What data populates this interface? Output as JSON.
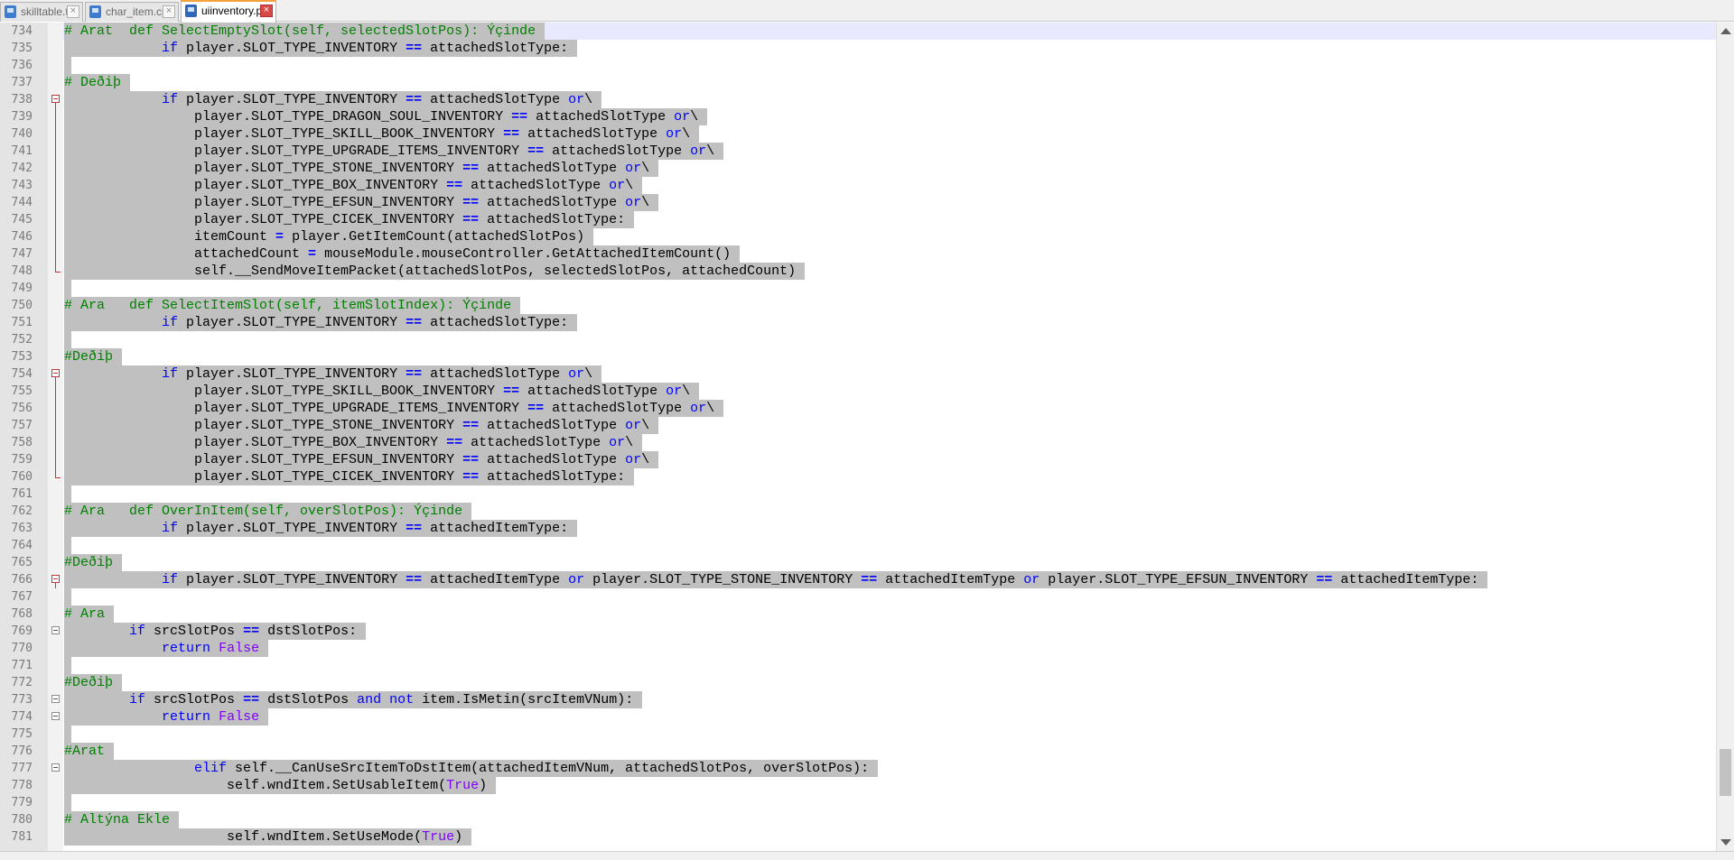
{
  "tabs": [
    {
      "label": "skilltable.txt",
      "active": false,
      "icon": "file-icon"
    },
    {
      "label": "char_item.cpp",
      "active": false,
      "icon": "file-icon"
    },
    {
      "label": "uiinventory.py",
      "active": true,
      "icon": "file-icon"
    }
  ],
  "colors": {
    "comment": "#008000",
    "keyword": "#0000ff",
    "boolean": "#8000ff",
    "selection": "#c0c0c0",
    "fold_marker": "#d03030",
    "active_tab_accent": "#f4a23c"
  },
  "editor": {
    "current_line": 734,
    "lines": [
      {
        "n": "734",
        "fold": null,
        "segs": [
          [
            "c",
            "# Arat  def SelectEmptySlot(self, selectedSlotPos): Ýçinde"
          ]
        ]
      },
      {
        "n": "735",
        "fold": null,
        "segs": [
          [
            "t",
            "            "
          ],
          [
            "k",
            "if"
          ],
          [
            "t",
            " player.SLOT_TYPE_INVENTORY "
          ],
          [
            "o",
            "=="
          ],
          [
            "t",
            " attachedSlotType:"
          ]
        ]
      },
      {
        "n": "736",
        "fold": null,
        "segs": []
      },
      {
        "n": "737",
        "fold": null,
        "segs": [
          [
            "c",
            "# Deðiþ"
          ]
        ]
      },
      {
        "n": "738",
        "fold": "start",
        "segs": [
          [
            "t",
            "            "
          ],
          [
            "k",
            "if"
          ],
          [
            "t",
            " player.SLOT_TYPE_INVENTORY "
          ],
          [
            "o",
            "=="
          ],
          [
            "t",
            " attachedSlotType "
          ],
          [
            "k",
            "or"
          ],
          [
            "t",
            "\\"
          ]
        ]
      },
      {
        "n": "739",
        "fold": "mid",
        "segs": [
          [
            "t",
            "                player.SLOT_TYPE_DRAGON_SOUL_INVENTORY "
          ],
          [
            "o",
            "=="
          ],
          [
            "t",
            " attachedSlotType "
          ],
          [
            "k",
            "or"
          ],
          [
            "t",
            "\\"
          ]
        ]
      },
      {
        "n": "740",
        "fold": "mid",
        "segs": [
          [
            "t",
            "                player.SLOT_TYPE_SKILL_BOOK_INVENTORY "
          ],
          [
            "o",
            "=="
          ],
          [
            "t",
            " attachedSlotType "
          ],
          [
            "k",
            "or"
          ],
          [
            "t",
            "\\"
          ]
        ]
      },
      {
        "n": "741",
        "fold": "mid",
        "segs": [
          [
            "t",
            "                player.SLOT_TYPE_UPGRADE_ITEMS_INVENTORY "
          ],
          [
            "o",
            "=="
          ],
          [
            "t",
            " attachedSlotType "
          ],
          [
            "k",
            "or"
          ],
          [
            "t",
            "\\"
          ]
        ]
      },
      {
        "n": "742",
        "fold": "mid",
        "segs": [
          [
            "t",
            "                player.SLOT_TYPE_STONE_INVENTORY "
          ],
          [
            "o",
            "=="
          ],
          [
            "t",
            " attachedSlotType "
          ],
          [
            "k",
            "or"
          ],
          [
            "t",
            "\\"
          ]
        ]
      },
      {
        "n": "743",
        "fold": "mid",
        "segs": [
          [
            "t",
            "                player.SLOT_TYPE_BOX_INVENTORY "
          ],
          [
            "o",
            "=="
          ],
          [
            "t",
            " attachedSlotType "
          ],
          [
            "k",
            "or"
          ],
          [
            "t",
            "\\"
          ]
        ]
      },
      {
        "n": "744",
        "fold": "mid",
        "segs": [
          [
            "t",
            "                player.SLOT_TYPE_EFSUN_INVENTORY "
          ],
          [
            "o",
            "=="
          ],
          [
            "t",
            " attachedSlotType "
          ],
          [
            "k",
            "or"
          ],
          [
            "t",
            "\\"
          ]
        ]
      },
      {
        "n": "745",
        "fold": "mid",
        "segs": [
          [
            "t",
            "                player.SLOT_TYPE_CICEK_INVENTORY "
          ],
          [
            "o",
            "=="
          ],
          [
            "t",
            " attachedSlotType:"
          ]
        ]
      },
      {
        "n": "746",
        "fold": "mid",
        "segs": [
          [
            "t",
            "                itemCount "
          ],
          [
            "o",
            "="
          ],
          [
            "t",
            " player.GetItemCount(attachedSlotPos)"
          ]
        ]
      },
      {
        "n": "747",
        "fold": "mid",
        "segs": [
          [
            "t",
            "                attachedCount "
          ],
          [
            "o",
            "="
          ],
          [
            "t",
            " mouseModule.mouseController.GetAttachedItemCount()"
          ]
        ]
      },
      {
        "n": "748",
        "fold": "end",
        "segs": [
          [
            "t",
            "                self.__SendMoveItemPacket(attachedSlotPos, selectedSlotPos, attachedCount)"
          ]
        ]
      },
      {
        "n": "749",
        "fold": null,
        "segs": []
      },
      {
        "n": "750",
        "fold": null,
        "segs": [
          [
            "c",
            "# Ara   def SelectItemSlot(self, itemSlotIndex): Ýçinde"
          ]
        ]
      },
      {
        "n": "751",
        "fold": null,
        "segs": [
          [
            "t",
            "            "
          ],
          [
            "k",
            "if"
          ],
          [
            "t",
            " player.SLOT_TYPE_INVENTORY "
          ],
          [
            "o",
            "=="
          ],
          [
            "t",
            " attachedSlotType:"
          ]
        ]
      },
      {
        "n": "752",
        "fold": null,
        "segs": []
      },
      {
        "n": "753",
        "fold": null,
        "segs": [
          [
            "c",
            "#Deðiþ"
          ]
        ]
      },
      {
        "n": "754",
        "fold": "start",
        "segs": [
          [
            "t",
            "            "
          ],
          [
            "k",
            "if"
          ],
          [
            "t",
            " player.SLOT_TYPE_INVENTORY "
          ],
          [
            "o",
            "=="
          ],
          [
            "t",
            " attachedSlotType "
          ],
          [
            "k",
            "or"
          ],
          [
            "t",
            "\\"
          ]
        ]
      },
      {
        "n": "755",
        "fold": "mid",
        "segs": [
          [
            "t",
            "                player.SLOT_TYPE_SKILL_BOOK_INVENTORY "
          ],
          [
            "o",
            "=="
          ],
          [
            "t",
            " attachedSlotType "
          ],
          [
            "k",
            "or"
          ],
          [
            "t",
            "\\"
          ]
        ]
      },
      {
        "n": "756",
        "fold": "mid",
        "segs": [
          [
            "t",
            "                player.SLOT_TYPE_UPGRADE_ITEMS_INVENTORY "
          ],
          [
            "o",
            "=="
          ],
          [
            "t",
            " attachedSlotType "
          ],
          [
            "k",
            "or"
          ],
          [
            "t",
            "\\"
          ]
        ]
      },
      {
        "n": "757",
        "fold": "mid",
        "segs": [
          [
            "t",
            "                player.SLOT_TYPE_STONE_INVENTORY "
          ],
          [
            "o",
            "=="
          ],
          [
            "t",
            " attachedSlotType "
          ],
          [
            "k",
            "or"
          ],
          [
            "t",
            "\\"
          ]
        ]
      },
      {
        "n": "758",
        "fold": "mid",
        "segs": [
          [
            "t",
            "                player.SLOT_TYPE_BOX_INVENTORY "
          ],
          [
            "o",
            "=="
          ],
          [
            "t",
            " attachedSlotType "
          ],
          [
            "k",
            "or"
          ],
          [
            "t",
            "\\"
          ]
        ]
      },
      {
        "n": "759",
        "fold": "mid",
        "segs": [
          [
            "t",
            "                player.SLOT_TYPE_EFSUN_INVENTORY "
          ],
          [
            "o",
            "=="
          ],
          [
            "t",
            " attachedSlotType "
          ],
          [
            "k",
            "or"
          ],
          [
            "t",
            "\\"
          ]
        ]
      },
      {
        "n": "760",
        "fold": "end",
        "segs": [
          [
            "t",
            "                player.SLOT_TYPE_CICEK_INVENTORY "
          ],
          [
            "o",
            "=="
          ],
          [
            "t",
            " attachedSlotType:"
          ]
        ]
      },
      {
        "n": "761",
        "fold": null,
        "segs": []
      },
      {
        "n": "762",
        "fold": null,
        "segs": [
          [
            "c",
            "# Ara   def OverInItem(self, overSlotPos): Ýçinde"
          ]
        ]
      },
      {
        "n": "763",
        "fold": null,
        "segs": [
          [
            "t",
            "            "
          ],
          [
            "k",
            "if"
          ],
          [
            "t",
            " player.SLOT_TYPE_INVENTORY "
          ],
          [
            "o",
            "=="
          ],
          [
            "t",
            " attachedItemType:"
          ]
        ]
      },
      {
        "n": "764",
        "fold": null,
        "segs": []
      },
      {
        "n": "765",
        "fold": null,
        "segs": [
          [
            "c",
            "#Deðiþ"
          ]
        ]
      },
      {
        "n": "766",
        "fold": "single",
        "segs": [
          [
            "t",
            "            "
          ],
          [
            "k",
            "if"
          ],
          [
            "t",
            " player.SLOT_TYPE_INVENTORY "
          ],
          [
            "o",
            "=="
          ],
          [
            "t",
            " attachedItemType "
          ],
          [
            "k",
            "or"
          ],
          [
            "t",
            " player.SLOT_TYPE_STONE_INVENTORY "
          ],
          [
            "o",
            "=="
          ],
          [
            "t",
            " attachedItemType "
          ],
          [
            "k",
            "or"
          ],
          [
            "t",
            " player.SLOT_TYPE_EFSUN_INVENTORY "
          ],
          [
            "o",
            "=="
          ],
          [
            "t",
            " attachedItemType:"
          ]
        ]
      },
      {
        "n": "767",
        "fold": null,
        "segs": []
      },
      {
        "n": "768",
        "fold": null,
        "segs": [
          [
            "c",
            "# Ara"
          ]
        ]
      },
      {
        "n": "769",
        "fold": "box",
        "segs": [
          [
            "t",
            "        "
          ],
          [
            "k",
            "if"
          ],
          [
            "t",
            " srcSlotPos "
          ],
          [
            "o",
            "=="
          ],
          [
            "t",
            " dstSlotPos:"
          ]
        ]
      },
      {
        "n": "770",
        "fold": null,
        "segs": [
          [
            "t",
            "            "
          ],
          [
            "k",
            "return"
          ],
          [
            "t",
            " "
          ],
          [
            "b",
            "False"
          ]
        ]
      },
      {
        "n": "771",
        "fold": null,
        "segs": []
      },
      {
        "n": "772",
        "fold": null,
        "segs": [
          [
            "c",
            "#Deðiþ"
          ]
        ]
      },
      {
        "n": "773",
        "fold": "box",
        "segs": [
          [
            "t",
            "        "
          ],
          [
            "k",
            "if"
          ],
          [
            "t",
            " srcSlotPos "
          ],
          [
            "o",
            "=="
          ],
          [
            "t",
            " dstSlotPos "
          ],
          [
            "k",
            "and"
          ],
          [
            "t",
            " "
          ],
          [
            "k",
            "not"
          ],
          [
            "t",
            " item.IsMetin(srcItemVNum):"
          ]
        ]
      },
      {
        "n": "774",
        "fold": "box",
        "segs": [
          [
            "t",
            "            "
          ],
          [
            "k",
            "return"
          ],
          [
            "t",
            " "
          ],
          [
            "b",
            "False"
          ]
        ]
      },
      {
        "n": "775",
        "fold": null,
        "segs": []
      },
      {
        "n": "776",
        "fold": null,
        "segs": [
          [
            "c",
            "#Arat"
          ]
        ]
      },
      {
        "n": "777",
        "fold": "box",
        "segs": [
          [
            "t",
            "                "
          ],
          [
            "k",
            "elif"
          ],
          [
            "t",
            " self.__CanUseSrcItemToDstItem(attachedItemVNum, attachedSlotPos, overSlotPos):"
          ]
        ]
      },
      {
        "n": "778",
        "fold": null,
        "segs": [
          [
            "t",
            "                    self.wndItem.SetUsableItem("
          ],
          [
            "b",
            "True"
          ],
          [
            "t",
            ")"
          ]
        ]
      },
      {
        "n": "779",
        "fold": null,
        "segs": []
      },
      {
        "n": "780",
        "fold": null,
        "segs": [
          [
            "c",
            "# Altýna Ekle"
          ]
        ]
      },
      {
        "n": "781",
        "fold": null,
        "segs": [
          [
            "t",
            "                    self.wndItem.SetUseMode("
          ],
          [
            "b",
            "True"
          ],
          [
            "t",
            ")"
          ]
        ]
      }
    ]
  },
  "scrollbar": {
    "position_fraction": 0.95
  }
}
